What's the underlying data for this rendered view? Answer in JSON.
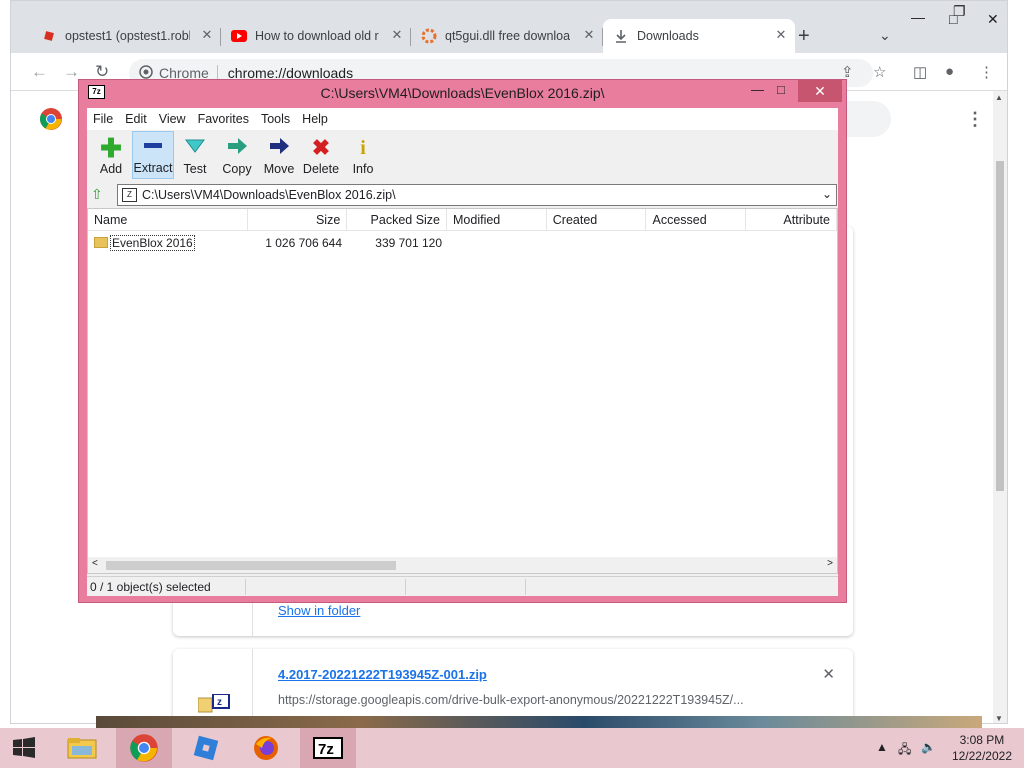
{
  "browser": {
    "tabs": [
      {
        "title": "opstest1 (opstest1.roblc",
        "icon": "roblox-icon",
        "active": false
      },
      {
        "title": "How to download old r",
        "icon": "youtube-icon",
        "active": false
      },
      {
        "title": "qt5gui.dll free downloa",
        "icon": "dll-site-icon",
        "active": false
      },
      {
        "title": "Downloads",
        "icon": "download-icon",
        "active": true
      }
    ],
    "omnibox": {
      "chip": "Chrome",
      "url": "chrome://downloads"
    }
  },
  "downloads": {
    "partial_link": "Show in folder",
    "item": {
      "filename": "4.2017-20221222T193945Z-001.zip",
      "url": "https://storage.googleapis.com/drive-bulk-export-anonymous/20221222T193945Z/..."
    }
  },
  "sevenzip": {
    "title": "C:\\Users\\VM4\\Downloads\\EvenBlox 2016.zip\\",
    "menu": [
      "File",
      "Edit",
      "View",
      "Favorites",
      "Tools",
      "Help"
    ],
    "tools": [
      {
        "label": "Add",
        "icon": "add-icon",
        "color": "#2eaa2e"
      },
      {
        "label": "Extract",
        "icon": "extract-icon",
        "color": "#1f3f9f"
      },
      {
        "label": "Test",
        "icon": "test-icon",
        "color": "#2ab0b0"
      },
      {
        "label": "Copy",
        "icon": "copy-icon",
        "color": "#1f8f6f"
      },
      {
        "label": "Move",
        "icon": "move-icon",
        "color": "#1f2f7f"
      },
      {
        "label": "Delete",
        "icon": "delete-icon",
        "color": "#d42020"
      },
      {
        "label": "Info",
        "icon": "info-icon",
        "color": "#d4b400"
      }
    ],
    "path": "C:\\Users\\VM4\\Downloads\\EvenBlox 2016.zip\\",
    "columns": [
      "Name",
      "Size",
      "Packed Size",
      "Modified",
      "Created",
      "Accessed",
      "Attribute"
    ],
    "rows": [
      {
        "name": "EvenBlox 2016",
        "size": "1 026 706 644",
        "packed": "339 701 120",
        "modified": "",
        "created": "",
        "accessed": "",
        "attributes": ""
      }
    ],
    "status": "0 / 1 object(s) selected"
  },
  "taskbar": {
    "apps": [
      "start-button",
      "file-explorer-icon",
      "chrome-icon",
      "roblox-studio-icon",
      "firefox-icon",
      "7zip-icon"
    ],
    "time": "3:08 PM",
    "date": "12/22/2022"
  }
}
